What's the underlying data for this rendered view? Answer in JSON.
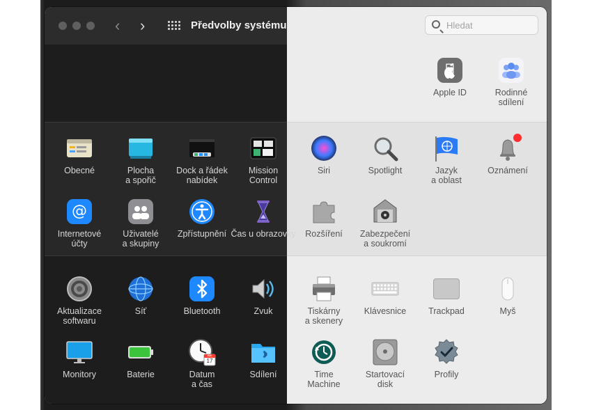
{
  "window": {
    "title": "Předvolby systému"
  },
  "search": {
    "placeholder": "Hledat"
  },
  "top_items": [
    {
      "label": "Apple ID",
      "icon": "apple-icon"
    },
    {
      "label": "Rodinné\nsdílení",
      "icon": "family-sharing-icon"
    }
  ],
  "row1": [
    {
      "label": "Obecné",
      "icon": "general-icon"
    },
    {
      "label": "Plocha\na spořič",
      "icon": "desktop-screensaver-icon"
    },
    {
      "label": "Dock a řádek\nnabídek",
      "icon": "dock-menubar-icon"
    },
    {
      "label": "Mission\nControl",
      "icon": "mission-control-icon"
    },
    {
      "label": "Siri",
      "icon": "siri-icon"
    },
    {
      "label": "Spotlight",
      "icon": "spotlight-icon"
    },
    {
      "label": "Jazyk\na oblast",
      "icon": "language-region-icon"
    },
    {
      "label": "Oznámení",
      "icon": "notifications-icon"
    }
  ],
  "row2": [
    {
      "label": "Internetové\núčty",
      "icon": "internet-accounts-icon"
    },
    {
      "label": "Uživatelé\na skupiny",
      "icon": "users-groups-icon"
    },
    {
      "label": "Zpřístupnění",
      "icon": "accessibility-icon"
    },
    {
      "label": "Čas u obrazovky",
      "icon": "screen-time-icon"
    },
    {
      "label": "Rozšíření",
      "icon": "extensions-icon"
    },
    {
      "label": "Zabezpečení\na soukromí",
      "icon": "security-privacy-icon"
    }
  ],
  "row3": [
    {
      "label": "Aktualizace\nsoftwaru",
      "icon": "software-update-icon"
    },
    {
      "label": "Síť",
      "icon": "network-icon"
    },
    {
      "label": "Bluetooth",
      "icon": "bluetooth-icon"
    },
    {
      "label": "Zvuk",
      "icon": "sound-icon"
    },
    {
      "label": "Tiskárny\na skenery",
      "icon": "printer-icon"
    },
    {
      "label": "Klávesnice",
      "icon": "keyboard-icon"
    },
    {
      "label": "Trackpad",
      "icon": "trackpad-icon"
    },
    {
      "label": "Myš",
      "icon": "mouse-icon"
    }
  ],
  "row4": [
    {
      "label": "Monitory",
      "icon": "display-icon"
    },
    {
      "label": "Baterie",
      "icon": "battery-icon"
    },
    {
      "label": "Datum\na čas",
      "icon": "date-time-icon"
    },
    {
      "label": "Sdílení",
      "icon": "sharing-icon"
    },
    {
      "label": "Time\nMachine",
      "icon": "time-machine-icon"
    },
    {
      "label": "Startovací\ndisk",
      "icon": "startup-disk-icon"
    },
    {
      "label": "Profily",
      "icon": "profiles-icon"
    }
  ],
  "date_icon": {
    "month": "JUL",
    "day": "17"
  },
  "colors": {
    "dark_bg": "#1e1e1e",
    "light_bg": "#ececec",
    "accent_blue": "#1e88ff",
    "badge_red": "#ff2d2d"
  }
}
